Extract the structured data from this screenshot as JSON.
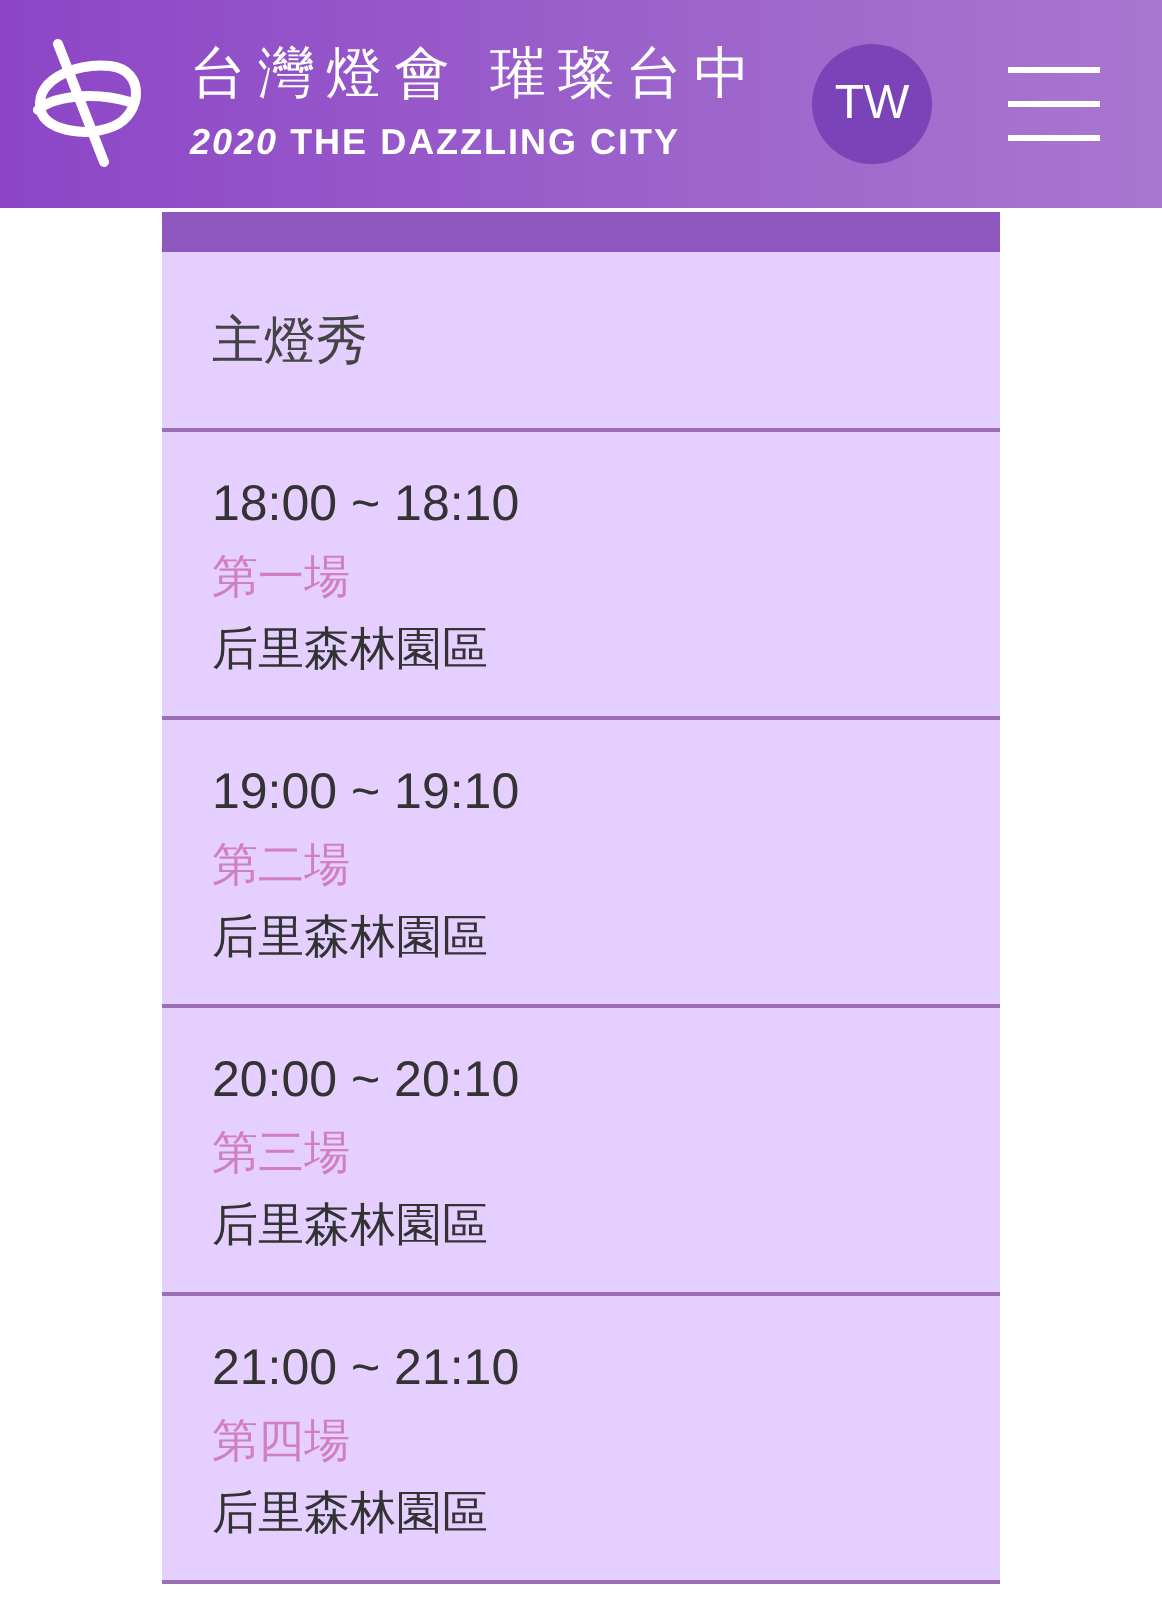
{
  "header": {
    "title": "台灣燈會 璀璨台中",
    "subtitle_year": "2020",
    "subtitle": "THE DAZZLING CITY",
    "language": "TW"
  },
  "section": {
    "title": "主燈秀"
  },
  "shows": [
    {
      "time": "18:00 ~ 18:10",
      "name": "第一場",
      "venue": "后里森林園區"
    },
    {
      "time": "19:00 ~ 19:10",
      "name": "第二場",
      "venue": "后里森林園區"
    },
    {
      "time": "20:00 ~ 20:10",
      "name": "第三場",
      "venue": "后里森林園區"
    },
    {
      "time": "21:00 ~ 21:10",
      "name": "第四場",
      "venue": "后里森林園區"
    }
  ]
}
